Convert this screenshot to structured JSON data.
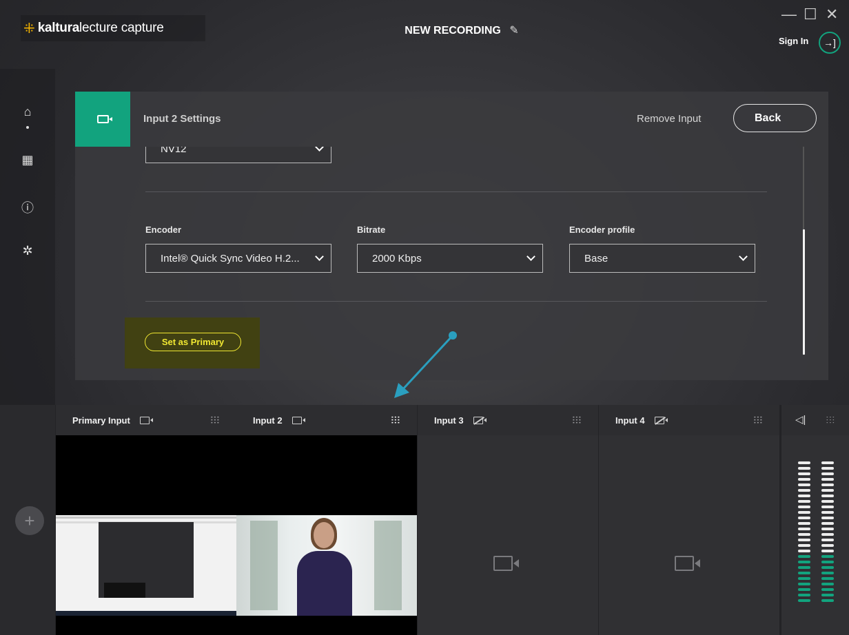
{
  "app": {
    "logo_bold": "kaltura",
    "logo_light": "lecture capture",
    "title": "NEW RECORDING"
  },
  "window_controls": {
    "minimize": "—",
    "maximize": "☐",
    "close": "✕"
  },
  "account": {
    "sign_in_label": "Sign In"
  },
  "rail": {
    "items": [
      {
        "icon": "home-icon",
        "glyph": "⌂"
      },
      {
        "icon": "calendar-icon",
        "glyph": "▦"
      },
      {
        "icon": "info-icon",
        "glyph": "ⓘ"
      },
      {
        "icon": "settings-icon",
        "glyph": "✲"
      }
    ]
  },
  "settings": {
    "title": "Input 2 Settings",
    "remove_label": "Remove Input",
    "back_label": "Back",
    "format_value": "NV12",
    "encoder_label": "Encoder",
    "encoder_value": "Intel® Quick Sync Video H.2...",
    "bitrate_label": "Bitrate",
    "bitrate_value": "2000 Kbps",
    "profile_label": "Encoder profile",
    "profile_value": "Base",
    "set_primary_label": "Set as Primary"
  },
  "inputs": [
    {
      "label": "Primary Input",
      "camera": "on",
      "state": "screen"
    },
    {
      "label": "Input 2",
      "camera": "on",
      "state": "camera",
      "mixer_active": true
    },
    {
      "label": "Input 3",
      "camera": "off",
      "state": "empty"
    },
    {
      "label": "Input 4",
      "camera": "off",
      "state": "empty"
    }
  ],
  "audio": {
    "levels": {
      "left": 0.35,
      "right": 0.35
    }
  },
  "colors": {
    "accent": "#12a37e",
    "highlight": "#f1e832",
    "panel": "#3a3a3e"
  }
}
